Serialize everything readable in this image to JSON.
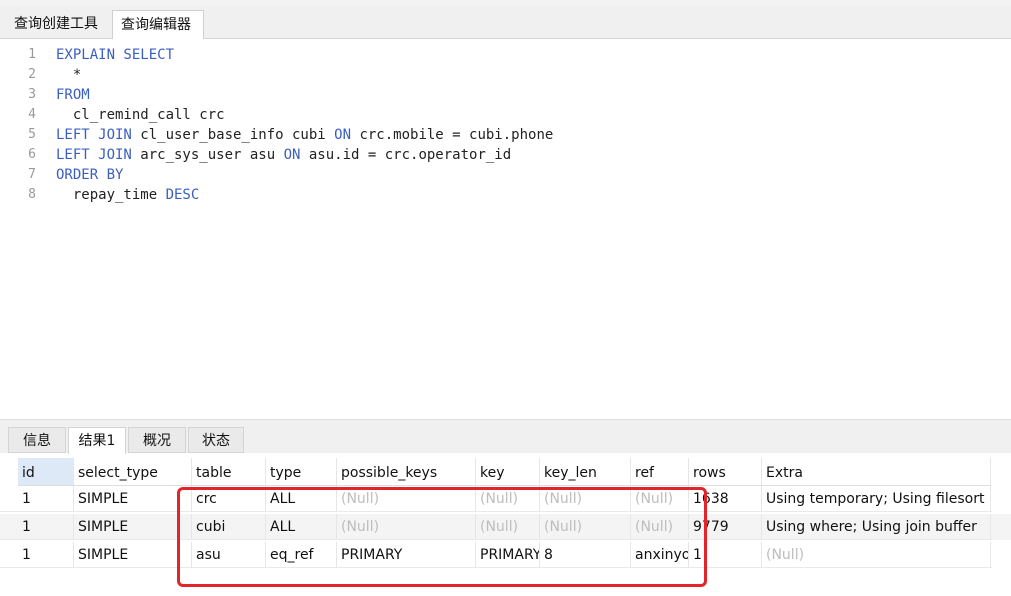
{
  "editor_tabs": [
    "查询创建工具",
    "查询编辑器"
  ],
  "editor": {
    "lines": [
      {
        "num": "1",
        "parts": [
          {
            "t": "EXPLAIN SELECT",
            "kw": true
          }
        ]
      },
      {
        "num": "2",
        "parts": [
          {
            "t": "  *",
            "kw": false
          }
        ]
      },
      {
        "num": "3",
        "parts": [
          {
            "t": "FROM",
            "kw": true
          }
        ]
      },
      {
        "num": "4",
        "parts": [
          {
            "t": "  cl_remind_call crc",
            "kw": false
          }
        ]
      },
      {
        "num": "5",
        "parts": [
          {
            "t": "LEFT JOIN",
            "kw": true
          },
          {
            "t": " cl_user_base_info cubi ",
            "kw": false
          },
          {
            "t": "ON",
            "kw": true
          },
          {
            "t": " crc.mobile = cubi.phone",
            "kw": false
          }
        ]
      },
      {
        "num": "6",
        "parts": [
          {
            "t": "LEFT JOIN",
            "kw": true
          },
          {
            "t": " arc_sys_user asu ",
            "kw": false
          },
          {
            "t": "ON",
            "kw": true
          },
          {
            "t": " asu.id = crc.operator_id",
            "kw": false
          }
        ]
      },
      {
        "num": "7",
        "parts": [
          {
            "t": "ORDER BY",
            "kw": true
          }
        ]
      },
      {
        "num": "8",
        "parts": [
          {
            "t": "  repay_time ",
            "kw": false
          },
          {
            "t": "DESC",
            "kw": true
          }
        ]
      }
    ]
  },
  "result_tabs": [
    {
      "label": "信息",
      "active": false
    },
    {
      "label": "结果1",
      "active": true
    },
    {
      "label": "概况",
      "active": false
    },
    {
      "label": "状态",
      "active": false
    }
  ],
  "grid": {
    "columns": [
      "id",
      "select_type",
      "table",
      "type",
      "possible_keys",
      "key",
      "key_len",
      "ref",
      "rows",
      "Extra"
    ],
    "rows": [
      [
        "1",
        "SIMPLE",
        "crc",
        "ALL",
        "(Null)",
        "(Null)",
        "(Null)",
        "(Null)",
        "1638",
        "Using temporary; Using filesort"
      ],
      [
        "1",
        "SIMPLE",
        "cubi",
        "ALL",
        "(Null)",
        "(Null)",
        "(Null)",
        "(Null)",
        "9779",
        "Using where; Using join buffer"
      ],
      [
        "1",
        "SIMPLE",
        "asu",
        "eq_ref",
        "PRIMARY",
        "PRIMARY",
        "8",
        "anxinyo",
        "1",
        "(Null)"
      ]
    ],
    "null_text": "(Null)"
  },
  "colors": {
    "keyword": "#3b5fc0",
    "null": "#bdbdbd",
    "highlight": "#e0262a"
  }
}
